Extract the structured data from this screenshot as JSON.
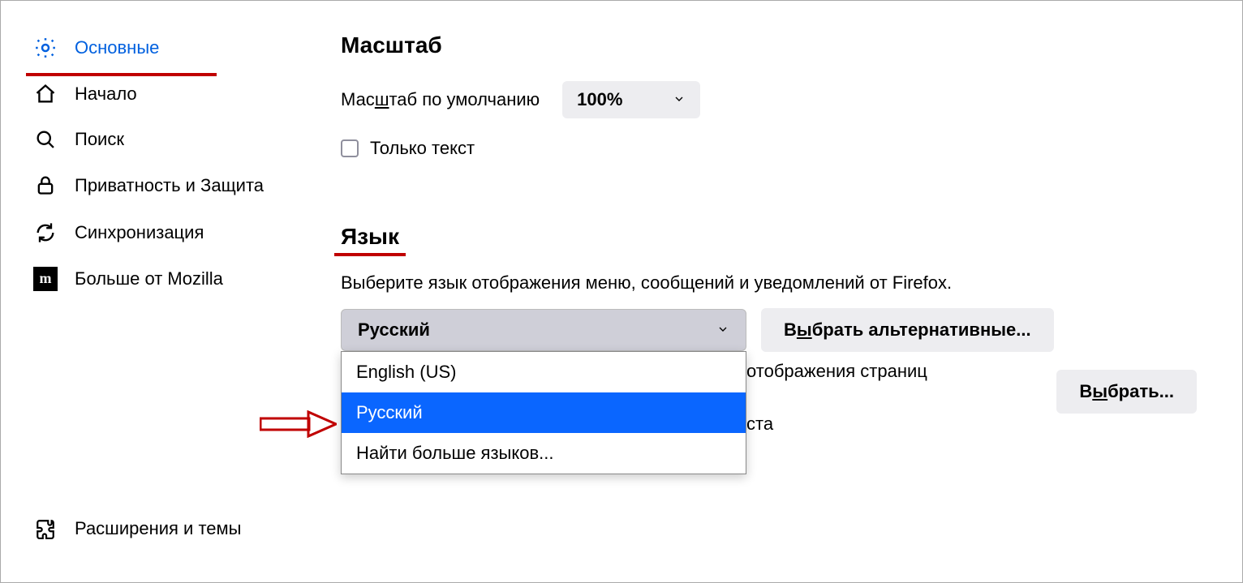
{
  "sidebar": {
    "items": [
      {
        "label": "Основные",
        "icon": "gear-icon",
        "active": true,
        "underlined": true
      },
      {
        "label": "Начало",
        "icon": "home-icon"
      },
      {
        "label": "Поиск",
        "icon": "search-icon"
      },
      {
        "label": "Приватность и Защита",
        "icon": "lock-icon",
        "multiline": true
      },
      {
        "label": "Синхронизация",
        "icon": "sync-icon"
      },
      {
        "label": "Больше от Mozilla",
        "icon": "mozilla-icon"
      }
    ],
    "footer": {
      "label": "Расширения и темы",
      "icon": "puzzle-icon"
    }
  },
  "zoom": {
    "heading": "Масштаб",
    "default_label_pre": "Мас",
    "default_label_ul": "ш",
    "default_label_post": "таб по умолчанию",
    "default_value": "100%",
    "text_only_pre": "Т",
    "text_only_ul": "о",
    "text_only_post": "лько текст"
  },
  "language": {
    "heading": "Язык",
    "description": "Выберите язык отображения меню, сообщений и уведомлений от Firefox.",
    "selected": "Русский",
    "options": [
      "English (US)",
      "Русский",
      "Найти больше языков..."
    ],
    "alternatives_btn_pre": "В",
    "alternatives_btn_ul": "ы",
    "alternatives_btn_post": "брать альтернативные...",
    "choose_btn_pre": "В",
    "choose_btn_ul": "ы",
    "choose_btn_post": "брать...",
    "partial_text_1": "отображения страниц",
    "partial_text_2": "ста"
  }
}
